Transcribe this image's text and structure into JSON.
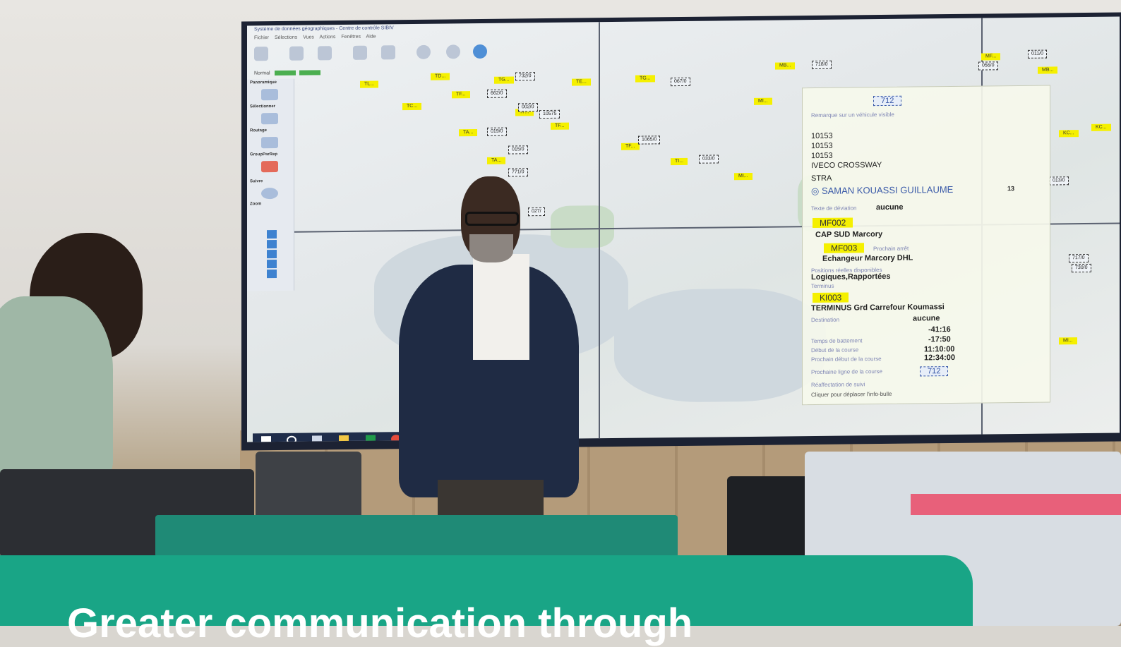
{
  "screen": {
    "title_bar": "Système de données géographiques - Centre de contrôle SIBIV",
    "menu": "Fichier  Sélections  Vues  Actions  Fenêtres  Aide",
    "normal_label": "Normal",
    "side_labels": [
      "Panoramique",
      "Sélectionner",
      "Routage",
      "GroupParRep",
      "Suivre",
      "Zoom"
    ]
  },
  "map_tags": [
    "TD...",
    "TL...",
    "TG...",
    "TF...",
    "TC...",
    "TE...",
    "TA...",
    "TI...",
    "MB...",
    "MI...",
    "MF...",
    "MB...",
    "KC...",
    "KD..."
  ],
  "bus_labels": [
    "732/0",
    "712/0",
    "662/0",
    "002/0",
    "10575",
    "019/0",
    "015/0",
    "771/0",
    "1065/0",
    "033/0",
    "067/0",
    "027/",
    "718/0",
    "011/0",
    "056/0",
    "013/0",
    "717/0",
    "730/0"
  ],
  "info_panel": {
    "route_top": "712",
    "remark": "Remarque sur un véhicule visible",
    "id1": "10153",
    "id2": "10153",
    "id3": "10153",
    "vehicle": "IVECO CROSSWAY",
    "company": "STRA",
    "driver": "SAMAN KOUASSI GUILLAUME",
    "driver_num": "13",
    "delay_label": "Texte de déviation",
    "delay_value": "aucune",
    "stop1": "MF002",
    "stop1_name": "CAP SUD Marcory",
    "stop2": "MF003",
    "stop2_label": "Prochain arrêt",
    "stop2_name": "Echangeur Marcory DHL",
    "positions_label": "Positions réelles disponibles",
    "positions_value": "Logiques,Rapportées",
    "terminus_label": "Terminus",
    "stop3": "KI003",
    "terminus_name": "TERMINUS Grd Carrefour Koumassi",
    "destination_label": "Destination",
    "destination_value": "aucune",
    "time1": "-41:16",
    "battement_label": "Temps de battement",
    "time2": "-17:50",
    "course_start_label": "Début de la course",
    "time3": "11:10:00",
    "next_start_label": "Prochain début de la course",
    "time4": "12:34:00",
    "next_line_label": "Prochaine ligne de la course",
    "route_bottom": "712",
    "reaffect_label": "Réaffectation de suivi",
    "hint": "Cliquer pour déplacer l'info-bulle"
  },
  "headline": "Greater communication through"
}
